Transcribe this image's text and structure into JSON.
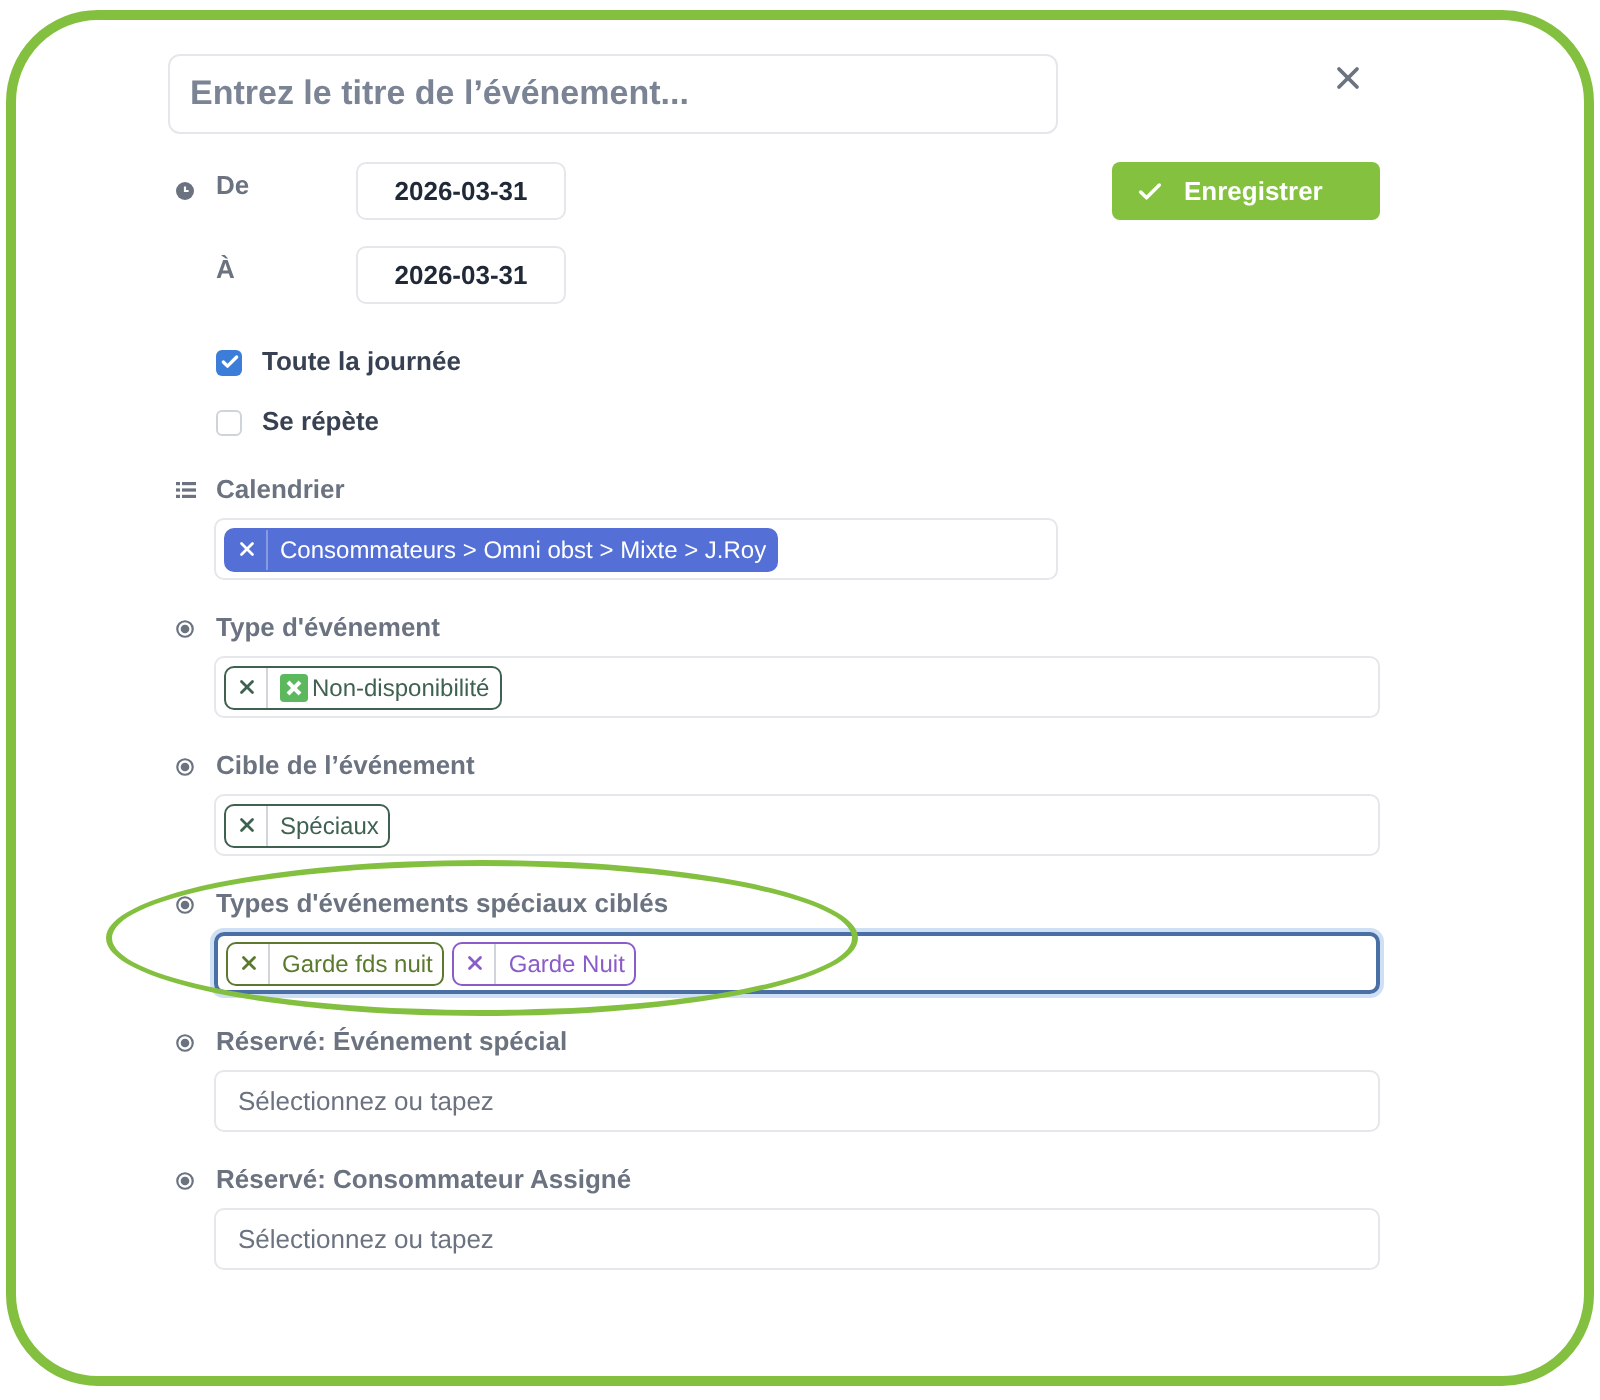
{
  "title_field": {
    "placeholder": "Entrez le titre de l’événement..."
  },
  "close_button": {
    "kind": "close"
  },
  "dates": [
    {
      "label": "De",
      "value": "2026-03-31"
    },
    {
      "label": "À",
      "value": "2026-03-31"
    }
  ],
  "save_button": {
    "label": "Enregistrer"
  },
  "checkboxes": [
    {
      "label": "Toute la journée",
      "checked": true
    },
    {
      "label": "Se répète",
      "checked": false
    }
  ],
  "fields": [
    {
      "label": "Calendrier",
      "kind": "calendar",
      "focused": false,
      "annotated": false,
      "tags": [
        {
          "label": "Consommateurs > Omni obst > Mixte > J.Roy",
          "kind": "solid",
          "color": "#5470d6"
        }
      ]
    },
    {
      "label": "Type d'événement",
      "kind": "select",
      "focused": false,
      "annotated": false,
      "tags": [
        {
          "label": "Non-disponibilité",
          "kind": "flagged",
          "color": "#3f6150"
        }
      ]
    },
    {
      "label": "Cible de l’événement",
      "kind": "select",
      "focused": false,
      "annotated": false,
      "tags": [
        {
          "label": "Spéciaux",
          "kind": "outline",
          "color": "#3f6150"
        }
      ]
    },
    {
      "label": "Types d'événements spéciaux ciblés",
      "kind": "select",
      "focused": true,
      "annotated": true,
      "tags": [
        {
          "label": "Garde fds nuit",
          "kind": "outline",
          "color": "#5b7a2e"
        },
        {
          "label": "Garde Nuit",
          "kind": "outline",
          "color": "#8a5cc9"
        }
      ]
    },
    {
      "label": "Réservé: Événement spécial",
      "kind": "select",
      "focused": false,
      "annotated": false,
      "placeholder": "Sélectionnez ou tapez"
    },
    {
      "label": "Réservé: Consommateur Assigné",
      "kind": "select",
      "focused": false,
      "annotated": false,
      "placeholder": "Sélectionnez ou tapez"
    }
  ]
}
